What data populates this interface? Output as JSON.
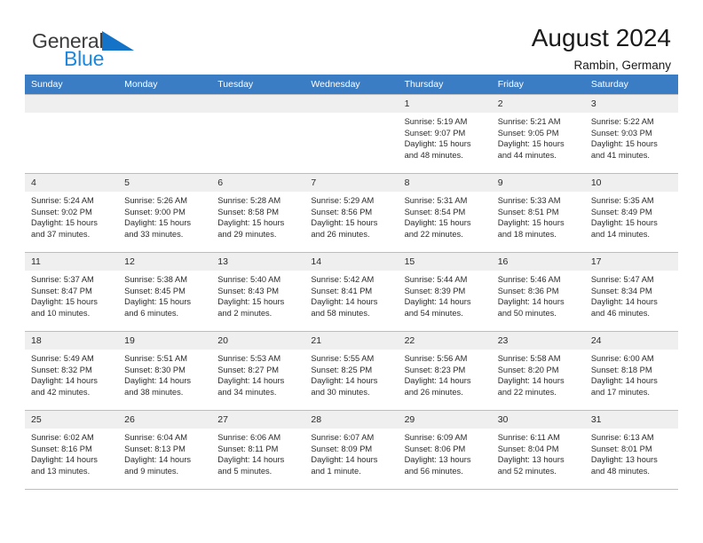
{
  "logo": {
    "word_top": "General",
    "word_bottom": "Blue",
    "triangle_color": "#1473c6",
    "blue_color": "#1c87dc"
  },
  "header": {
    "title": "August 2024",
    "location": "Rambin, Germany"
  },
  "theme": {
    "header_bar": "#3b7dc4",
    "daynum_bg": "#efefef",
    "grid_line": "#bdbdbd"
  },
  "weekday_headers": [
    "Sunday",
    "Monday",
    "Tuesday",
    "Wednesday",
    "Thursday",
    "Friday",
    "Saturday"
  ],
  "labels": {
    "sunrise": "Sunrise:",
    "sunset": "Sunset:",
    "daylight": "Daylight:"
  },
  "weeks": [
    [
      {
        "day": "",
        "empty": true
      },
      {
        "day": "",
        "empty": true
      },
      {
        "day": "",
        "empty": true
      },
      {
        "day": "",
        "empty": true
      },
      {
        "day": "1",
        "sunrise": "Sunrise: 5:19 AM",
        "sunset": "Sunset: 9:07 PM",
        "daylight_1": "Daylight: 15 hours",
        "daylight_2": "and 48 minutes."
      },
      {
        "day": "2",
        "sunrise": "Sunrise: 5:21 AM",
        "sunset": "Sunset: 9:05 PM",
        "daylight_1": "Daylight: 15 hours",
        "daylight_2": "and 44 minutes."
      },
      {
        "day": "3",
        "sunrise": "Sunrise: 5:22 AM",
        "sunset": "Sunset: 9:03 PM",
        "daylight_1": "Daylight: 15 hours",
        "daylight_2": "and 41 minutes."
      }
    ],
    [
      {
        "day": "4",
        "sunrise": "Sunrise: 5:24 AM",
        "sunset": "Sunset: 9:02 PM",
        "daylight_1": "Daylight: 15 hours",
        "daylight_2": "and 37 minutes."
      },
      {
        "day": "5",
        "sunrise": "Sunrise: 5:26 AM",
        "sunset": "Sunset: 9:00 PM",
        "daylight_1": "Daylight: 15 hours",
        "daylight_2": "and 33 minutes."
      },
      {
        "day": "6",
        "sunrise": "Sunrise: 5:28 AM",
        "sunset": "Sunset: 8:58 PM",
        "daylight_1": "Daylight: 15 hours",
        "daylight_2": "and 29 minutes."
      },
      {
        "day": "7",
        "sunrise": "Sunrise: 5:29 AM",
        "sunset": "Sunset: 8:56 PM",
        "daylight_1": "Daylight: 15 hours",
        "daylight_2": "and 26 minutes."
      },
      {
        "day": "8",
        "sunrise": "Sunrise: 5:31 AM",
        "sunset": "Sunset: 8:54 PM",
        "daylight_1": "Daylight: 15 hours",
        "daylight_2": "and 22 minutes."
      },
      {
        "day": "9",
        "sunrise": "Sunrise: 5:33 AM",
        "sunset": "Sunset: 8:51 PM",
        "daylight_1": "Daylight: 15 hours",
        "daylight_2": "and 18 minutes."
      },
      {
        "day": "10",
        "sunrise": "Sunrise: 5:35 AM",
        "sunset": "Sunset: 8:49 PM",
        "daylight_1": "Daylight: 15 hours",
        "daylight_2": "and 14 minutes."
      }
    ],
    [
      {
        "day": "11",
        "sunrise": "Sunrise: 5:37 AM",
        "sunset": "Sunset: 8:47 PM",
        "daylight_1": "Daylight: 15 hours",
        "daylight_2": "and 10 minutes."
      },
      {
        "day": "12",
        "sunrise": "Sunrise: 5:38 AM",
        "sunset": "Sunset: 8:45 PM",
        "daylight_1": "Daylight: 15 hours",
        "daylight_2": "and 6 minutes."
      },
      {
        "day": "13",
        "sunrise": "Sunrise: 5:40 AM",
        "sunset": "Sunset: 8:43 PM",
        "daylight_1": "Daylight: 15 hours",
        "daylight_2": "and 2 minutes."
      },
      {
        "day": "14",
        "sunrise": "Sunrise: 5:42 AM",
        "sunset": "Sunset: 8:41 PM",
        "daylight_1": "Daylight: 14 hours",
        "daylight_2": "and 58 minutes."
      },
      {
        "day": "15",
        "sunrise": "Sunrise: 5:44 AM",
        "sunset": "Sunset: 8:39 PM",
        "daylight_1": "Daylight: 14 hours",
        "daylight_2": "and 54 minutes."
      },
      {
        "day": "16",
        "sunrise": "Sunrise: 5:46 AM",
        "sunset": "Sunset: 8:36 PM",
        "daylight_1": "Daylight: 14 hours",
        "daylight_2": "and 50 minutes."
      },
      {
        "day": "17",
        "sunrise": "Sunrise: 5:47 AM",
        "sunset": "Sunset: 8:34 PM",
        "daylight_1": "Daylight: 14 hours",
        "daylight_2": "and 46 minutes."
      }
    ],
    [
      {
        "day": "18",
        "sunrise": "Sunrise: 5:49 AM",
        "sunset": "Sunset: 8:32 PM",
        "daylight_1": "Daylight: 14 hours",
        "daylight_2": "and 42 minutes."
      },
      {
        "day": "19",
        "sunrise": "Sunrise: 5:51 AM",
        "sunset": "Sunset: 8:30 PM",
        "daylight_1": "Daylight: 14 hours",
        "daylight_2": "and 38 minutes."
      },
      {
        "day": "20",
        "sunrise": "Sunrise: 5:53 AM",
        "sunset": "Sunset: 8:27 PM",
        "daylight_1": "Daylight: 14 hours",
        "daylight_2": "and 34 minutes."
      },
      {
        "day": "21",
        "sunrise": "Sunrise: 5:55 AM",
        "sunset": "Sunset: 8:25 PM",
        "daylight_1": "Daylight: 14 hours",
        "daylight_2": "and 30 minutes."
      },
      {
        "day": "22",
        "sunrise": "Sunrise: 5:56 AM",
        "sunset": "Sunset: 8:23 PM",
        "daylight_1": "Daylight: 14 hours",
        "daylight_2": "and 26 minutes."
      },
      {
        "day": "23",
        "sunrise": "Sunrise: 5:58 AM",
        "sunset": "Sunset: 8:20 PM",
        "daylight_1": "Daylight: 14 hours",
        "daylight_2": "and 22 minutes."
      },
      {
        "day": "24",
        "sunrise": "Sunrise: 6:00 AM",
        "sunset": "Sunset: 8:18 PM",
        "daylight_1": "Daylight: 14 hours",
        "daylight_2": "and 17 minutes."
      }
    ],
    [
      {
        "day": "25",
        "sunrise": "Sunrise: 6:02 AM",
        "sunset": "Sunset: 8:16 PM",
        "daylight_1": "Daylight: 14 hours",
        "daylight_2": "and 13 minutes."
      },
      {
        "day": "26",
        "sunrise": "Sunrise: 6:04 AM",
        "sunset": "Sunset: 8:13 PM",
        "daylight_1": "Daylight: 14 hours",
        "daylight_2": "and 9 minutes."
      },
      {
        "day": "27",
        "sunrise": "Sunrise: 6:06 AM",
        "sunset": "Sunset: 8:11 PM",
        "daylight_1": "Daylight: 14 hours",
        "daylight_2": "and 5 minutes."
      },
      {
        "day": "28",
        "sunrise": "Sunrise: 6:07 AM",
        "sunset": "Sunset: 8:09 PM",
        "daylight_1": "Daylight: 14 hours",
        "daylight_2": "and 1 minute."
      },
      {
        "day": "29",
        "sunrise": "Sunrise: 6:09 AM",
        "sunset": "Sunset: 8:06 PM",
        "daylight_1": "Daylight: 13 hours",
        "daylight_2": "and 56 minutes."
      },
      {
        "day": "30",
        "sunrise": "Sunrise: 6:11 AM",
        "sunset": "Sunset: 8:04 PM",
        "daylight_1": "Daylight: 13 hours",
        "daylight_2": "and 52 minutes."
      },
      {
        "day": "31",
        "sunrise": "Sunrise: 6:13 AM",
        "sunset": "Sunset: 8:01 PM",
        "daylight_1": "Daylight: 13 hours",
        "daylight_2": "and 48 minutes."
      }
    ]
  ]
}
